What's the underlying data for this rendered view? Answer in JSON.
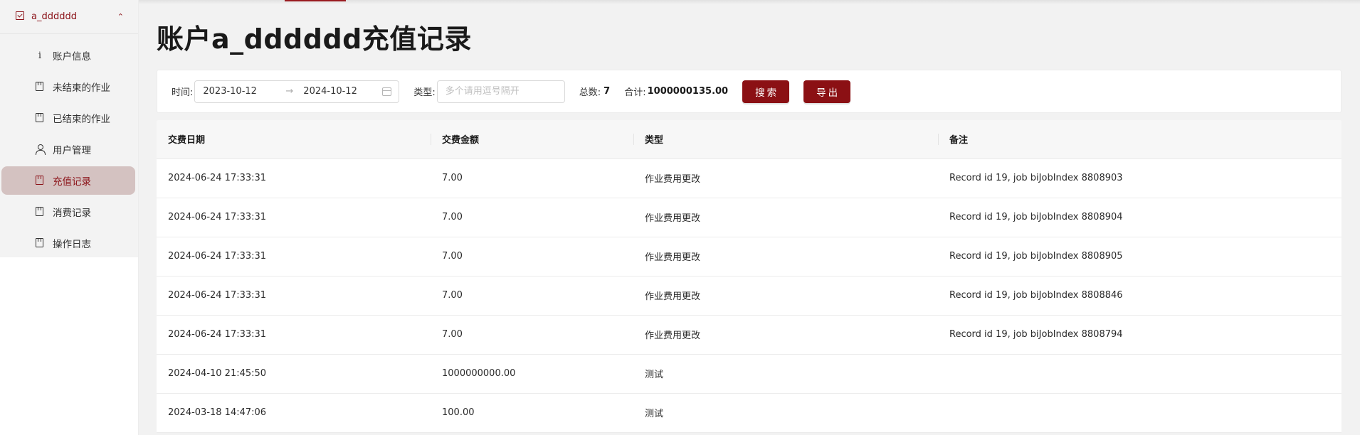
{
  "sidebar": {
    "account_label": "a_dddddd",
    "items": [
      {
        "label": "账户信息",
        "icon": "info-icon",
        "active": false
      },
      {
        "label": "未结束的作业",
        "icon": "document-icon",
        "active": false
      },
      {
        "label": "已结束的作业",
        "icon": "document-icon",
        "active": false
      },
      {
        "label": "用户管理",
        "icon": "user-icon",
        "active": false
      },
      {
        "label": "充值记录",
        "icon": "document-icon",
        "active": true
      },
      {
        "label": "消费记录",
        "icon": "document-icon",
        "active": false
      },
      {
        "label": "操作日志",
        "icon": "document-icon",
        "active": false
      }
    ]
  },
  "page": {
    "title": "账户a_dddddd充值记录"
  },
  "filters": {
    "time_label": "时间:",
    "start_date": "2023-10-12",
    "separator": "→",
    "end_date": "2024-10-12",
    "type_label": "类型:",
    "type_placeholder": "多个请用逗号隔开",
    "type_value": "",
    "total_count_label": "总数:",
    "total_count": "7",
    "sum_label": "合计:",
    "sum_value": "1000000135.00",
    "search_button": "搜索",
    "export_button": "导出"
  },
  "table": {
    "columns": [
      "交费日期",
      "交费金额",
      "类型",
      "备注"
    ],
    "rows": [
      [
        "2024-06-24 17:33:31",
        "7.00",
        "作业费用更改",
        "Record id 19, job biJobIndex 8808903"
      ],
      [
        "2024-06-24 17:33:31",
        "7.00",
        "作业费用更改",
        "Record id 19, job biJobIndex 8808904"
      ],
      [
        "2024-06-24 17:33:31",
        "7.00",
        "作业费用更改",
        "Record id 19, job biJobIndex 8808905"
      ],
      [
        "2024-06-24 17:33:31",
        "7.00",
        "作业费用更改",
        "Record id 19, job biJobIndex 8808846"
      ],
      [
        "2024-06-24 17:33:31",
        "7.00",
        "作业费用更改",
        "Record id 19, job biJobIndex 8808794"
      ],
      [
        "2024-04-10 21:45:50",
        "1000000000.00",
        "测试",
        ""
      ],
      [
        "2024-03-18 14:47:06",
        "100.00",
        "测试",
        ""
      ]
    ]
  },
  "colors": {
    "accent": "#8b1014",
    "active_menu_bg": "#d4c2c1",
    "page_bg": "#f2f2f2"
  }
}
